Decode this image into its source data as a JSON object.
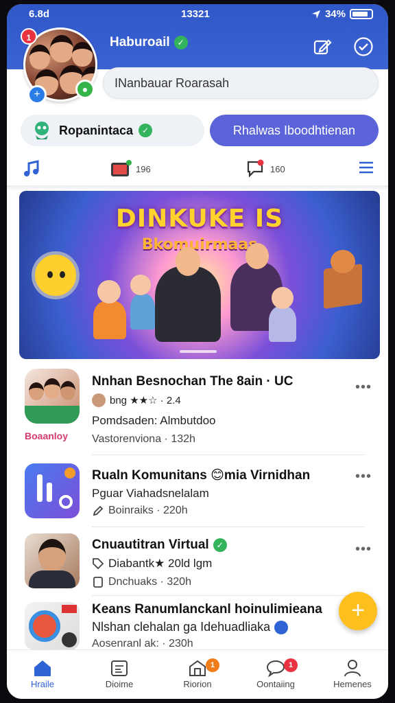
{
  "status_bar": {
    "left": "6.8d",
    "time": "13321",
    "battery": "34%"
  },
  "header": {
    "username": "Haburoail",
    "search_value": "INanbauar Roarasah",
    "notification_count": "1"
  },
  "actions": {
    "left_pill_label": "Ropanintaca",
    "right_pill_label": "Rhalwas Iboodhtienan"
  },
  "icon_row": {
    "center_count": "196",
    "chat_count": "160"
  },
  "banner": {
    "title": "DINKUKE IS",
    "subtitle": "Bkomuirmaas"
  },
  "list_items": [
    {
      "title": "Nnhan Besnochan The 8ain · UC",
      "line2": "bng ★★☆ · 2.4",
      "line3": "Pomdsaden: Almbutdoo",
      "line4": "Vastorenviona · 132h",
      "thumb_caption": "Boaanloy"
    },
    {
      "title": "Rualn Komunitans 😊mia Virnidhan",
      "line2": "Pguar Viahadsnelalam",
      "line3": "Boinraiks · 220h"
    },
    {
      "title": "Cnuautitran Virtual",
      "line2": "Diabantk★ 20ld lgm",
      "line3": "Dnchuaks · 320h"
    },
    {
      "title": "Keans Ranumlanckanl hoinulimieana",
      "line2": "Nlshan clehalan ga Idehuadliaka",
      "line3": "Aosenranl ak: · 230h"
    }
  ],
  "fab": {
    "label": "+"
  },
  "tab_bar": [
    {
      "label": "Hraile",
      "badge": ""
    },
    {
      "label": "Dioime",
      "badge": ""
    },
    {
      "label": "Riorion",
      "badge": "1"
    },
    {
      "label": "Oontaiing",
      "badge": "1"
    },
    {
      "label": "Hemenes",
      "badge": ""
    }
  ],
  "colors": {
    "header_blue": "#2f57c8",
    "accent_purple": "#5b63d8",
    "fab_yellow": "#fcbf1e",
    "badge_red": "#ea3340",
    "active_tab": "#2f62d4"
  }
}
